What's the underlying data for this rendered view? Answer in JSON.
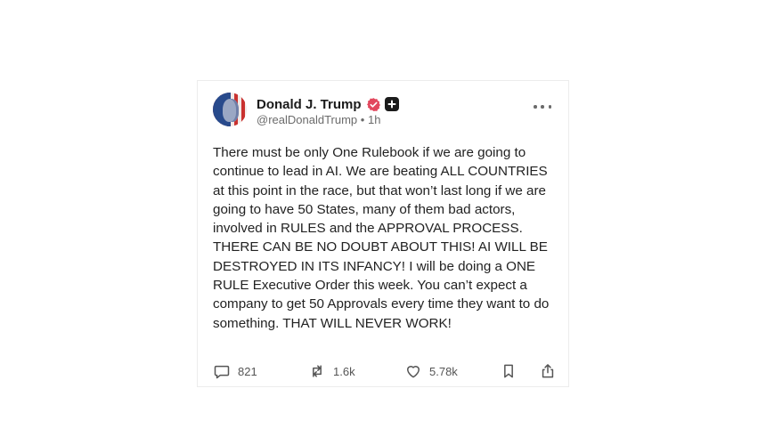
{
  "post": {
    "author_name": "Donald J. Trump",
    "handle": "@realDonaldTrump",
    "separator": "•",
    "time": "1h",
    "text": "There must be only One Rulebook if we are going to continue to lead in AI. We are beating ALL COUNTRIES at this point in the race, but that won’t last long if we are going to have 50 States, many of them bad actors, involved in RULES and the APPROVAL PROCESS. THERE CAN BE NO DOUBT ABOUT THIS! AI WILL BE DESTROYED IN ITS INFANCY! I will be doing a ONE RULE Executive Order this week. You can’t expect a company to get 50 Approvals every time they want to do something. THAT WILL NEVER WORK!"
  },
  "actions": {
    "replies": "821",
    "reposts": "1.6k",
    "likes": "5.78k"
  },
  "icons": {
    "verified": "verified-badge-icon",
    "plus": "plus-badge-icon",
    "more": "more-options-icon",
    "reply": "comment-icon",
    "repost": "repost-icon",
    "like": "heart-icon",
    "bookmark": "bookmark-icon",
    "share": "share-icon"
  },
  "colors": {
    "verified_badge": "#e2475d",
    "text": "#222222",
    "muted": "#6b6b6b",
    "card_border": "#ececec"
  }
}
